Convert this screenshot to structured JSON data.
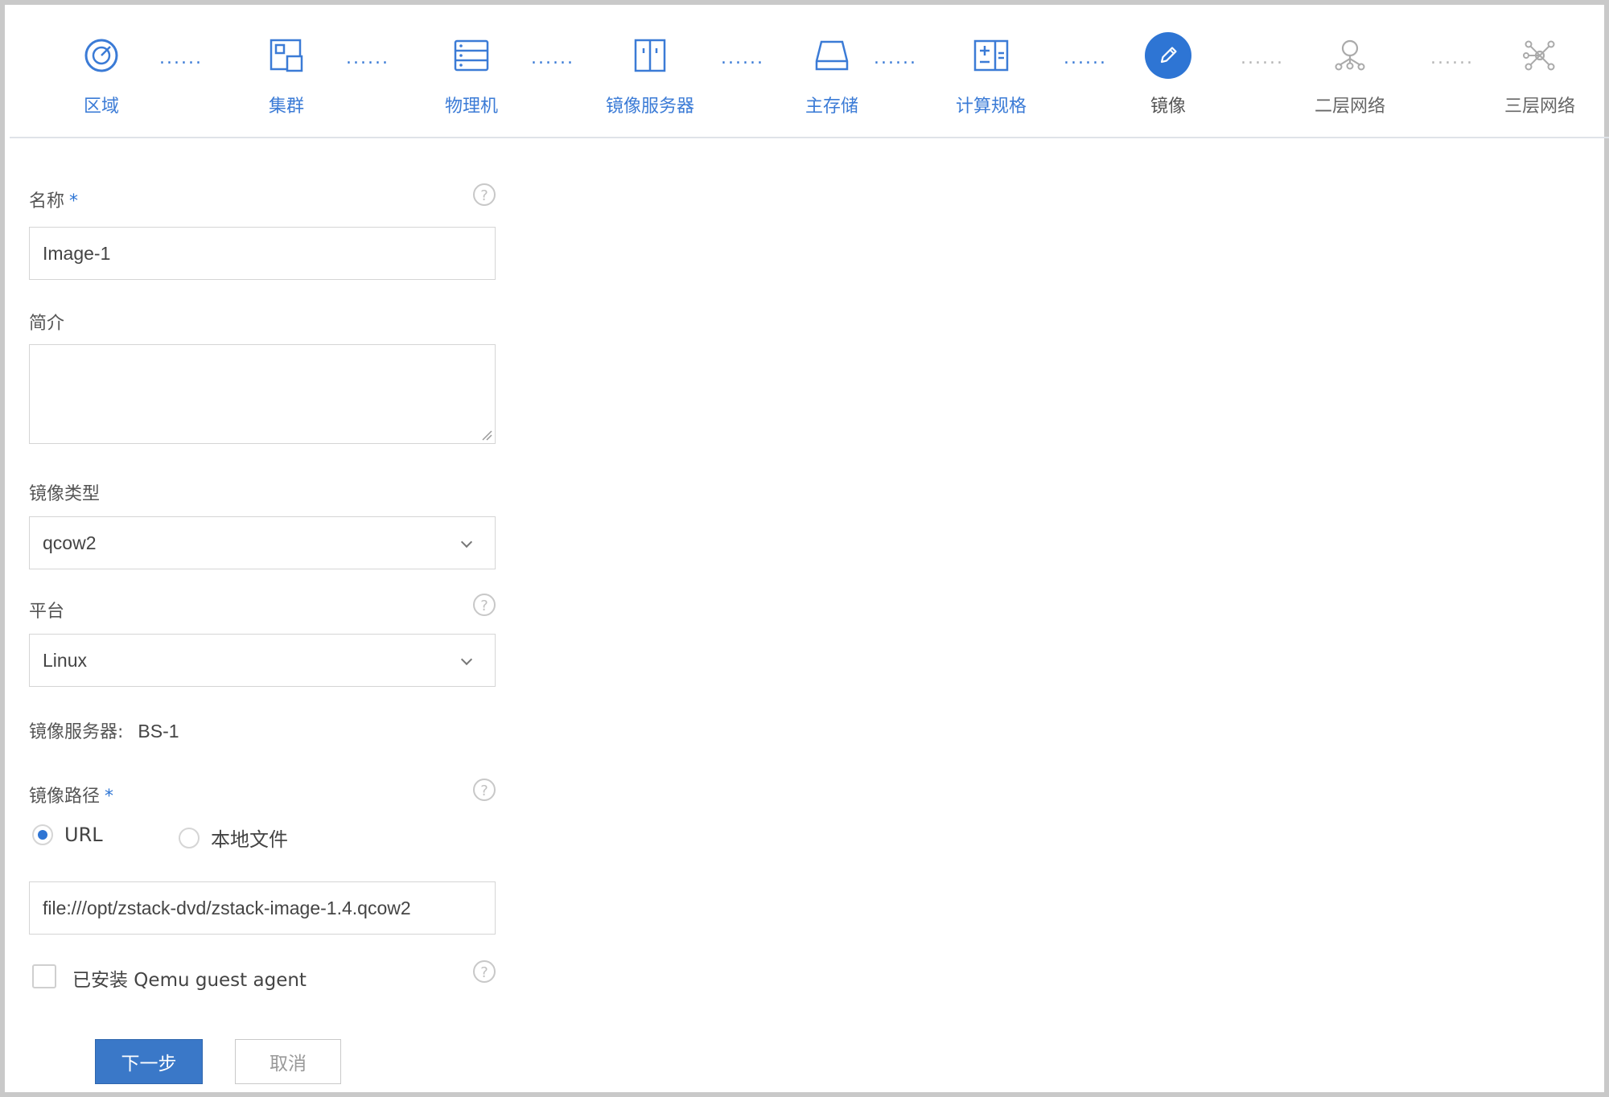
{
  "colors": {
    "accent": "#2e75d4",
    "primary_button": "#3a78c8"
  },
  "wizard": {
    "steps": [
      {
        "label": "区域",
        "icon": "zone-icon",
        "state": "done"
      },
      {
        "label": "集群",
        "icon": "cluster-icon",
        "state": "done"
      },
      {
        "label": "物理机",
        "icon": "host-icon",
        "state": "done"
      },
      {
        "label": "镜像服务器",
        "icon": "backup-storage-icon",
        "state": "done"
      },
      {
        "label": "主存储",
        "icon": "primary-storage-icon",
        "state": "done"
      },
      {
        "label": "计算规格",
        "icon": "instance-offering-icon",
        "state": "done"
      },
      {
        "label": "镜像",
        "icon": "pencil-icon",
        "state": "active"
      },
      {
        "label": "二层网络",
        "icon": "l2-network-icon",
        "state": "future"
      },
      {
        "label": "三层网络",
        "icon": "l3-network-icon",
        "state": "future"
      }
    ],
    "dots": "......"
  },
  "form": {
    "name": {
      "label": "名称",
      "required_mark": "*",
      "value": "Image-1"
    },
    "description": {
      "label": "简介",
      "value": ""
    },
    "image_type": {
      "label": "镜像类型",
      "value": "qcow2"
    },
    "platform": {
      "label": "平台",
      "value": "Linux"
    },
    "backup_storage": {
      "label": "镜像服务器:",
      "value": "BS-1"
    },
    "image_path": {
      "label": "镜像路径",
      "required_mark": "*",
      "options": [
        "URL",
        "本地文件"
      ],
      "selected": "URL",
      "value": "file:///opt/zstack-dvd/zstack-image-1.4.qcow2"
    },
    "qemu_agent": {
      "label": "已安装 Qemu guest agent",
      "checked": false
    },
    "help_glyph": "?"
  },
  "buttons": {
    "next": "下一步",
    "cancel": "取消"
  }
}
